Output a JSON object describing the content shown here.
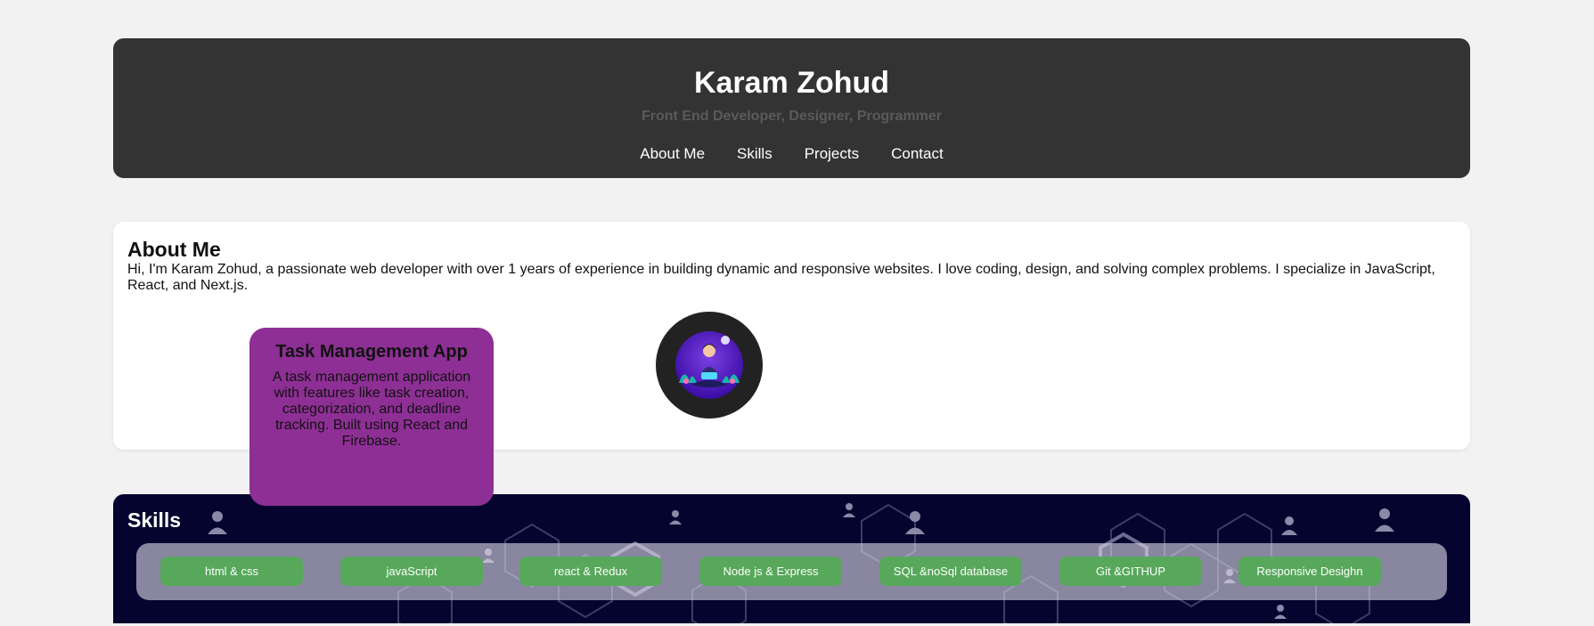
{
  "header": {
    "title": "Karam Zohud",
    "subtitle": "Front End Developer, Designer, Programmer",
    "nav": [
      "About Me",
      "Skills",
      "Projects",
      "Contact"
    ]
  },
  "about": {
    "title": "About Me",
    "text": "Hi, I'm Karam Zohud, a passionate web developer with over 1 years of experience in building dynamic and responsive websites. I love coding, design, and solving complex problems. I specialize in JavaScript, React, and Next.js."
  },
  "project": {
    "title": "Task Management App",
    "description": "A task management application with features like task creation, categorization, and deadline tracking. Built using React and Firebase."
  },
  "skills": {
    "title": "Skills",
    "items": [
      "html & css",
      "javaScript",
      "react & Redux",
      "Node js & Express",
      "SQL &noSql database",
      "Git &GITHUP",
      "Responsive Desighn"
    ]
  },
  "colors": {
    "header_bg": "#333333",
    "project_card": "#8e2f95",
    "skills_bg": "#05042f",
    "skill_pill": "#57a85a"
  }
}
